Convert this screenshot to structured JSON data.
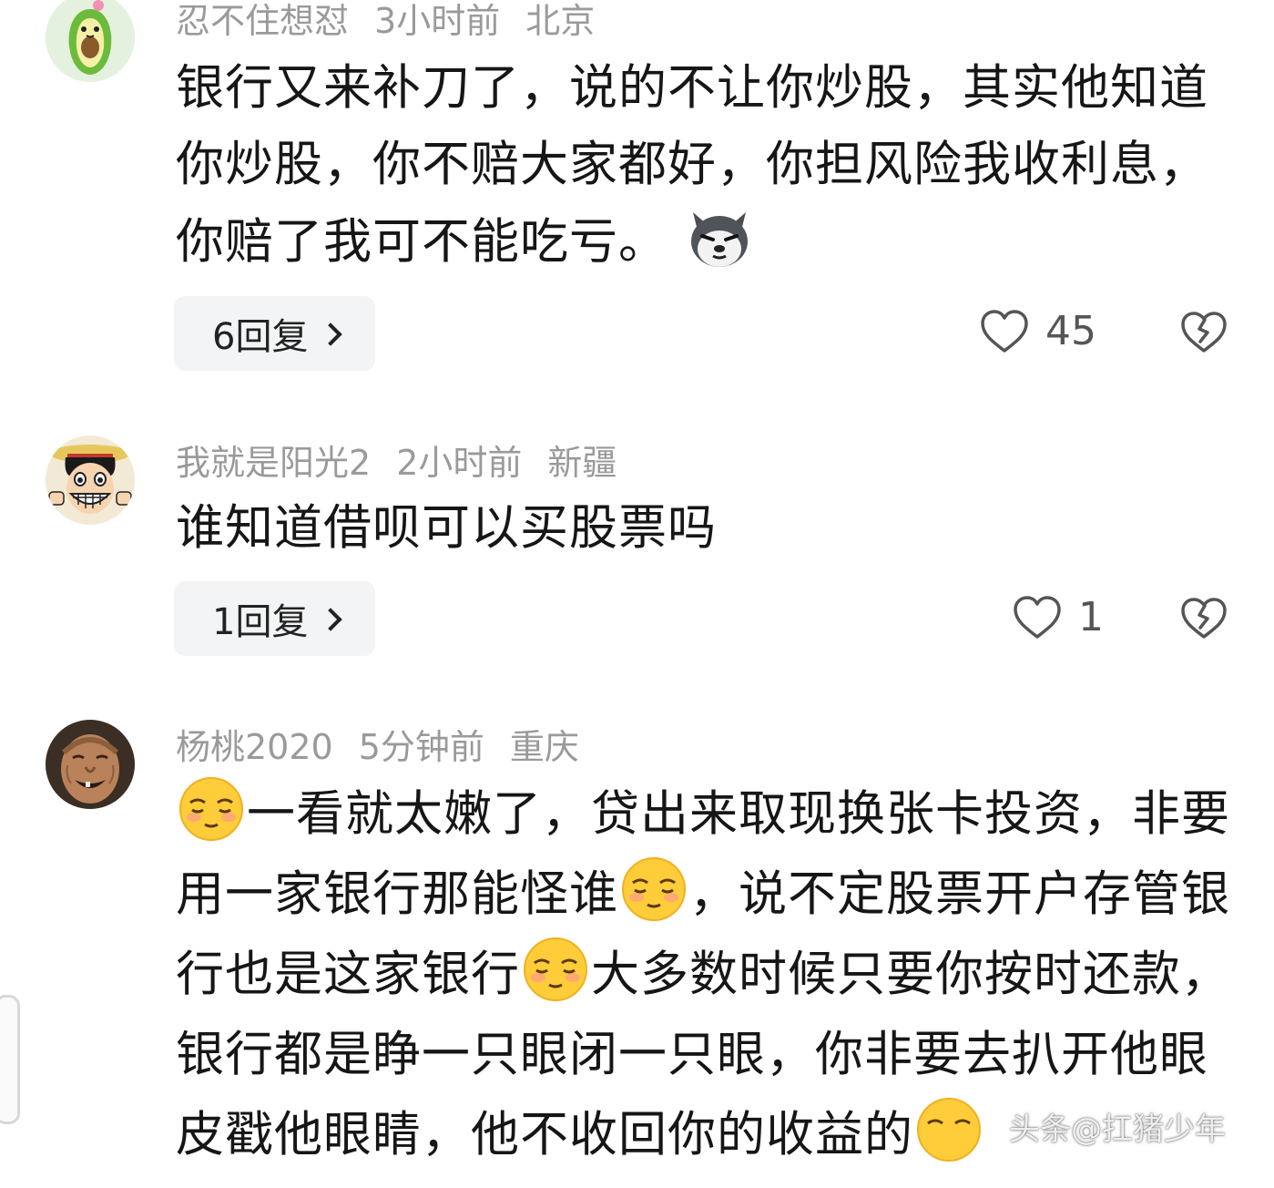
{
  "comments": [
    {
      "avatar_icon": "avocado-avatar-icon",
      "username": "忍不住想怼",
      "time": "3小时前",
      "location": "北京",
      "text_parts": [
        "银行又来补刀了，说的不让你炒股，其实他知道你炒股，你不赔大家都好，你担风险我收利息，你赔了我可不能吃亏。"
      ],
      "emoji_names": [
        "husky-dog-emoji"
      ],
      "replies_label": "6回复",
      "likes": "45"
    },
    {
      "avatar_icon": "luffy-avatar-icon",
      "username": "我就是阳光2",
      "time": "2小时前",
      "location": "新疆",
      "text_parts": [
        "谁知道借呗可以买股票吗"
      ],
      "replies_label": "1回复",
      "likes": "1"
    },
    {
      "avatar_icon": "old-man-avatar-icon",
      "username": "杨桃2020",
      "time": "5分钟前",
      "location": "重庆",
      "text_parts": [
        "一看就太嫩了，贷出来取现换张卡投资，非要用一家银行那能怪谁",
        "，说不定股票开户存管银行也是这家银行",
        "大多数时候只要你按时还款，银行都是睁一只眼闭一只眼，你非要去扒开他眼皮戳他眼睛，他不收回你的收益的"
      ],
      "emoji_names": [
        "relieved-face-emoji",
        "relieved-face-emoji",
        "relieved-face-emoji",
        "relieved-face-emoji"
      ]
    }
  ],
  "watermark": "头条@扛猪少年",
  "colors": {
    "meta_gray": "#9a9a9a",
    "reply_bg": "#f3f4f5",
    "text": "#161616"
  }
}
